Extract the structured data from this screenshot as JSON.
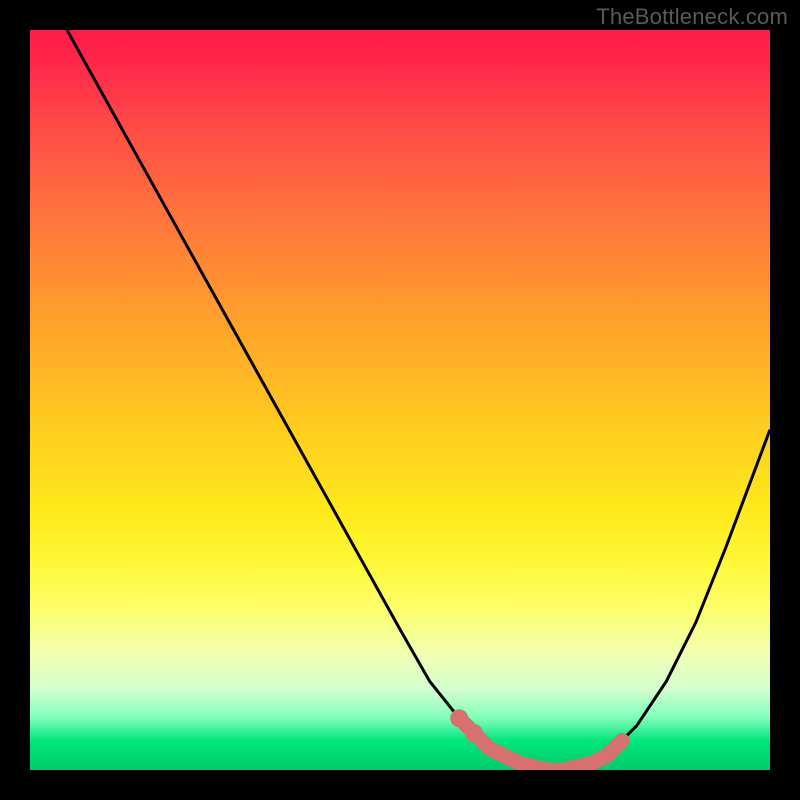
{
  "watermark": "TheBottleneck.com",
  "colors": {
    "frame": "#000000",
    "curve": "#000000",
    "marker": "#d87070",
    "gradient_top": "#ff1a4a",
    "gradient_mid": "#ffe91a",
    "gradient_bottom": "#00cc6b"
  },
  "chart_data": {
    "type": "line",
    "title": "",
    "xlabel": "",
    "ylabel": "",
    "xlim": [
      0,
      100
    ],
    "ylim": [
      0,
      100
    ],
    "grid": false,
    "legend": false,
    "series": [
      {
        "name": "bottleneck-curve",
        "x": [
          5,
          10,
          15,
          20,
          25,
          30,
          35,
          40,
          45,
          50,
          54,
          58,
          62,
          66,
          70,
          74,
          78,
          82,
          86,
          90,
          94,
          100
        ],
        "y": [
          100,
          91,
          82,
          73,
          64,
          55,
          46,
          37,
          28,
          19,
          12,
          7,
          3,
          1,
          0,
          0,
          2,
          6,
          12,
          20,
          30,
          46
        ]
      }
    ],
    "markers": {
      "name": "highlight",
      "points": [
        {
          "x": 58,
          "y": 7
        },
        {
          "x": 60,
          "y": 5
        },
        {
          "x": 62,
          "y": 3
        },
        {
          "x": 64,
          "y": 2
        },
        {
          "x": 66,
          "y": 1
        },
        {
          "x": 68,
          "y": 0.5
        },
        {
          "x": 70,
          "y": 0
        },
        {
          "x": 72,
          "y": 0
        },
        {
          "x": 74,
          "y": 0.5
        },
        {
          "x": 76,
          "y": 1
        },
        {
          "x": 78,
          "y": 2
        },
        {
          "x": 80,
          "y": 4
        }
      ]
    }
  }
}
